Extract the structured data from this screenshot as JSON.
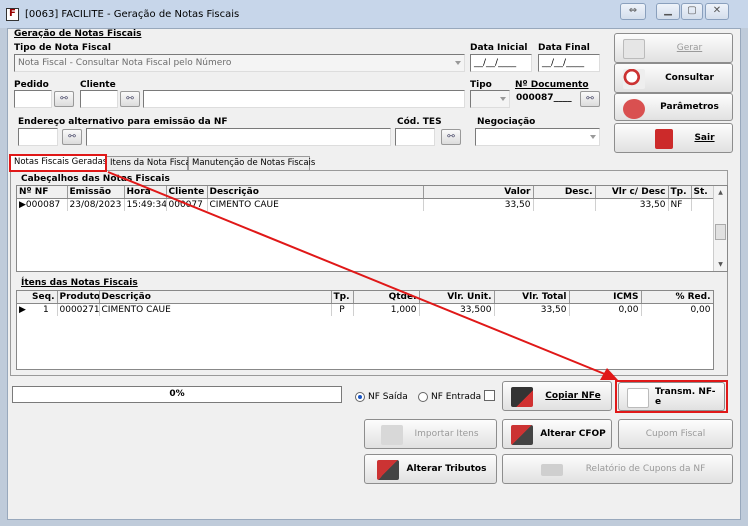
{
  "window": {
    "title": "[0063] FACILITE - Geração de Notas Fiscais"
  },
  "form": {
    "group_title": "Geração de Notas Fiscais",
    "tipo_label": "Tipo de Nota Fiscal",
    "tipo_value": "Nota Fiscal - Consultar Nota Fiscal pelo Número",
    "data_inicial_label": "Data Inicial",
    "data_inicial_value": "__/__/____",
    "data_final_label": "Data Final",
    "data_final_value": "__/__/____",
    "pedido_label": "Pedido",
    "cliente_label": "Cliente",
    "tipo2_label": "Tipo",
    "ndoc_label": "Nº Documento",
    "ndoc_value": "000087____",
    "endereco_label": "Endereço alternativo para emissão da NF",
    "codtes_label": "Cód. TES",
    "negociacao_label": "Negociação"
  },
  "side_buttons": {
    "gerar": "Gerar",
    "consultar": "Consultar",
    "parametros": "Parâmetros",
    "sair": "Sair"
  },
  "tabs": [
    "Notas Fiscais Geradas",
    "Itens da Nota Fiscal",
    "Manutenção de Notas Fiscais"
  ],
  "headers_grid": {
    "title": "Cabeçalhos das Notas Fiscais",
    "columns": [
      "Nº NF",
      "Emissão",
      "Hora",
      "Cliente",
      "Descrição",
      "Valor",
      "Desc.",
      "Vlr c/ Desc",
      "Tp.",
      "St."
    ],
    "rows": [
      [
        "000087",
        "23/08/2023",
        "15:49:34",
        "000077",
        "CIMENTO CAUE",
        "33,50",
        "",
        "33,50",
        "NF",
        ""
      ]
    ]
  },
  "items_grid": {
    "title": "Ítens das Notas Fiscais",
    "columns": [
      "Seq.",
      "Produto",
      "Descrição",
      "Tp.",
      "Qtde.",
      "Vlr. Unit.",
      "Vlr. Total",
      "ICMS",
      "% Red."
    ],
    "rows": [
      [
        "1",
        "0000271",
        "CIMENTO CAUE",
        "P",
        "1,000",
        "33,500",
        "33,50",
        "0,00",
        "0,00"
      ]
    ]
  },
  "bottom": {
    "progress_text": "0%",
    "progress_value": 0,
    "radio_saida": "NF Saída",
    "radio_entrada": "NF Entrada",
    "copiar_nfe": "Copiar NFe",
    "transm_nfe": "Transm. NF-e",
    "importar_itens": "Importar Itens",
    "alterar_cfop": "Alterar CFOP",
    "cupom_fiscal": "Cupom Fiscal",
    "alterar_tributos": "Alterar Tributos",
    "relatorio_cupons": "Relatório de Cupons da NF"
  },
  "colors": {
    "highlight": "#e01818",
    "accent": "#1a56c4"
  }
}
